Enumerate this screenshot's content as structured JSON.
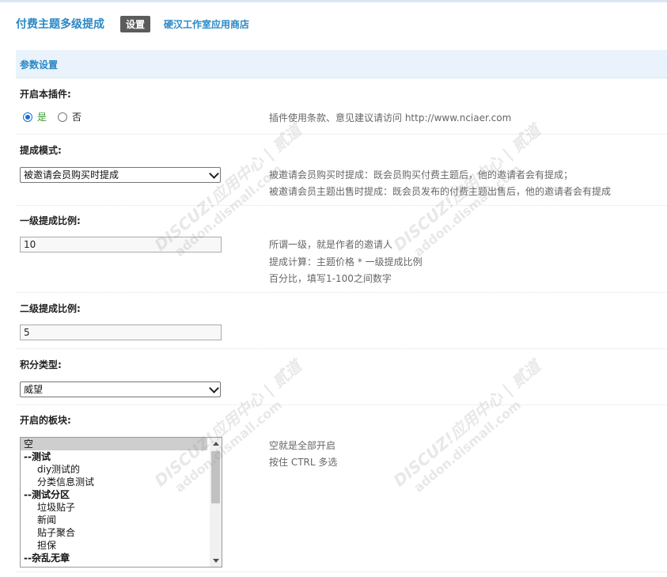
{
  "header": {
    "title": "付费主题多级提成",
    "settings_badge": "设置",
    "store_link": "硬汉工作室应用商店"
  },
  "section": {
    "title": "参数设置"
  },
  "enable_plugin": {
    "label": "开启本插件:",
    "options": [
      {
        "label": "是",
        "checked": true
      },
      {
        "label": "否",
        "checked": false
      }
    ],
    "hint": "插件使用条款、意见建议请访问 http://www.nciaer.com"
  },
  "commission_mode": {
    "label": "提成模式:",
    "selected": "被邀请会员购买时提成",
    "hints": [
      "被邀请会员购买时提成：既会员购买付费主题后，他的邀请者会有提成；",
      "被邀请会员主题出售时提成：既会员发布的付费主题出售后，他的邀请者会有提成"
    ]
  },
  "level1_ratio": {
    "label": "一级提成比例:",
    "value": "10",
    "hints": [
      "所谓一级，就是作者的邀请人",
      "提成计算：主题价格 * 一级提成比例",
      "百分比，填写1-100之间数字"
    ]
  },
  "level2_ratio": {
    "label": "二级提成比例:",
    "value": "5"
  },
  "credit_type": {
    "label": "积分类型:",
    "selected": "威望"
  },
  "forums": {
    "label": "开启的板块:",
    "options": [
      {
        "label": "空",
        "kind": "selected"
      },
      {
        "label": "--测试",
        "kind": "group"
      },
      {
        "label": "diy测试的",
        "kind": "sub"
      },
      {
        "label": "分类信息测试",
        "kind": "sub"
      },
      {
        "label": "--测试分区",
        "kind": "group"
      },
      {
        "label": "垃圾贴子",
        "kind": "sub"
      },
      {
        "label": "新闻",
        "kind": "sub"
      },
      {
        "label": "贴子聚合",
        "kind": "sub"
      },
      {
        "label": "担保",
        "kind": "sub"
      },
      {
        "label": "--杂乱无章",
        "kind": "group"
      }
    ],
    "hints": [
      "空就是全部开启",
      "按住 CTRL 多选"
    ]
  },
  "watermark": {
    "line1": "DISCUZ!应用中心 | 贰道",
    "line2": "addon.dismall.com"
  }
}
